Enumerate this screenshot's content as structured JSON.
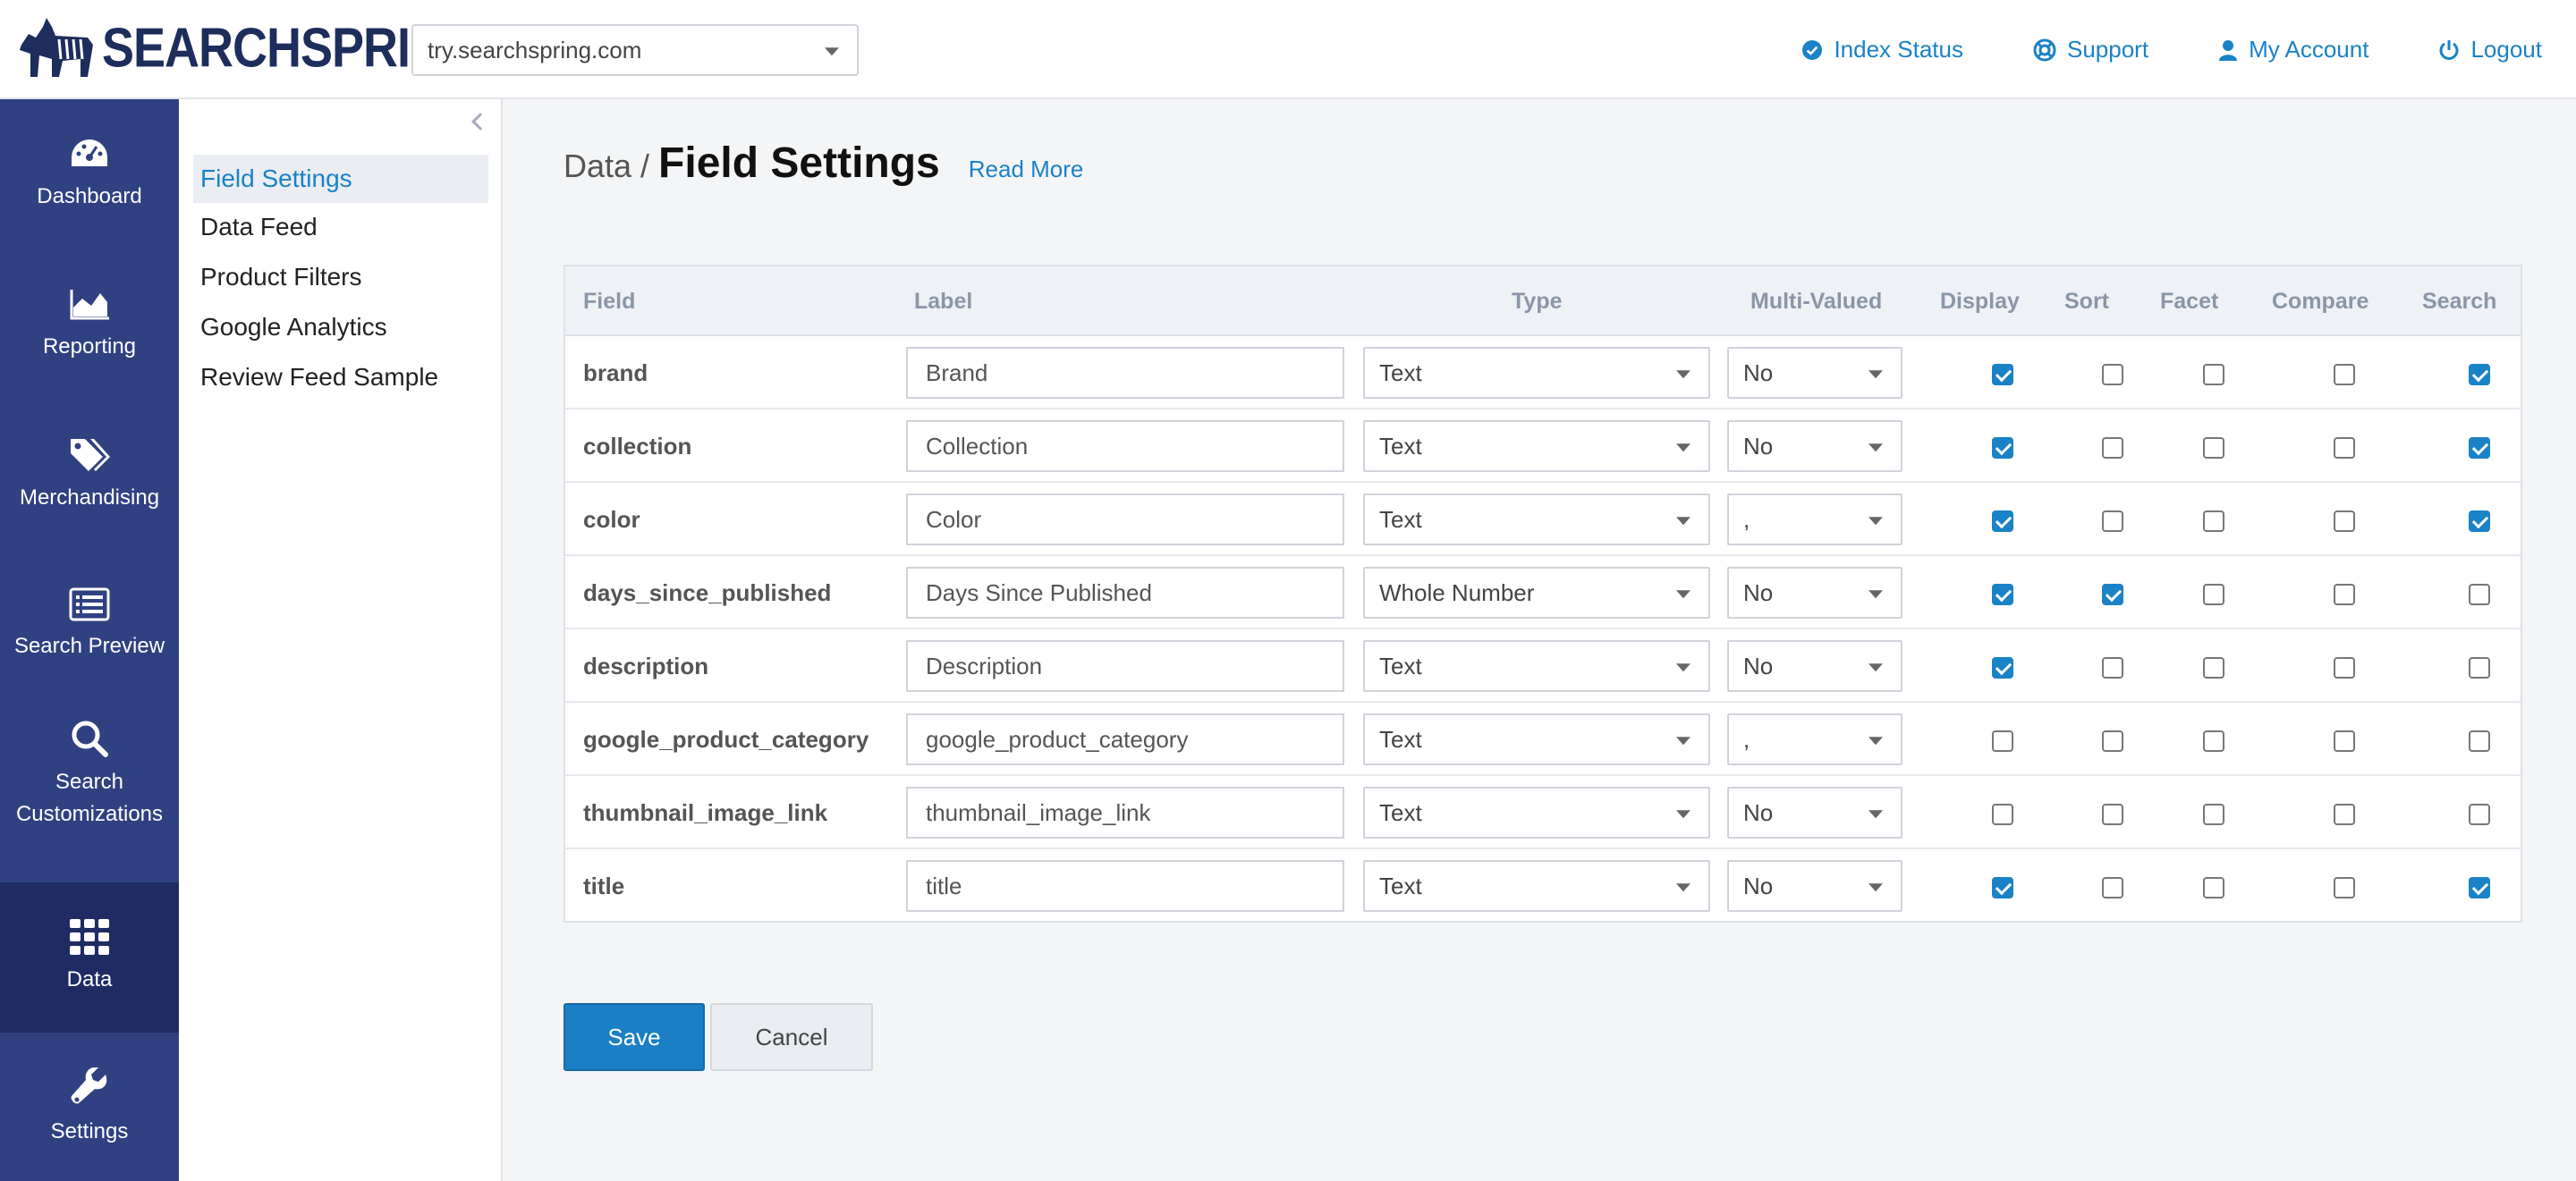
{
  "brand": {
    "name": "SEARCHSPRING",
    "reg": "®"
  },
  "site_selector": {
    "value": "try.searchspring.com"
  },
  "topnav": {
    "index_status": "Index Status",
    "support": "Support",
    "my_account": "My Account",
    "logout": "Logout"
  },
  "sidebar": {
    "items": [
      {
        "label": "Dashboard",
        "icon": "gauge-icon"
      },
      {
        "label": "Reporting",
        "icon": "area-chart-icon"
      },
      {
        "label": "Merchandising",
        "icon": "tags-icon"
      },
      {
        "label": "Search Preview",
        "icon": "list-icon"
      },
      {
        "label": "Search Customizations",
        "icon": "search-icon"
      },
      {
        "label": "Data",
        "icon": "grid-icon",
        "active": true
      },
      {
        "label": "Settings",
        "icon": "wrench-icon"
      }
    ]
  },
  "submenu": {
    "items": [
      {
        "label": "Field Settings",
        "active": true
      },
      {
        "label": "Data Feed"
      },
      {
        "label": "Product Filters"
      },
      {
        "label": "Google Analytics"
      },
      {
        "label": "Review Feed Sample"
      }
    ]
  },
  "page": {
    "crumb": "Data /",
    "title": "Field Settings",
    "read_more": "Read More"
  },
  "table": {
    "headers": {
      "field": "Field",
      "label": "Label",
      "type": "Type",
      "multi": "Multi-Valued",
      "display": "Display",
      "sort": "Sort",
      "facet": "Facet",
      "compare": "Compare",
      "search": "Search"
    },
    "rows": [
      {
        "field": "brand",
        "label": "Brand",
        "type": "Text",
        "multi": "No",
        "display": true,
        "sort": false,
        "facet": false,
        "compare": false,
        "search": true
      },
      {
        "field": "collection",
        "label": "Collection",
        "type": "Text",
        "multi": "No",
        "display": true,
        "sort": false,
        "facet": false,
        "compare": false,
        "search": true
      },
      {
        "field": "color",
        "label": "Color",
        "type": "Text",
        "multi": ",",
        "display": true,
        "sort": false,
        "facet": false,
        "compare": false,
        "search": true
      },
      {
        "field": "days_since_published",
        "label": "Days Since Published",
        "type": "Whole Number",
        "multi": "No",
        "display": true,
        "sort": true,
        "facet": false,
        "compare": false,
        "search": false
      },
      {
        "field": "description",
        "label": "Description",
        "type": "Text",
        "multi": "No",
        "display": true,
        "sort": false,
        "facet": false,
        "compare": false,
        "search": false
      },
      {
        "field": "google_product_category",
        "label": "google_product_category",
        "type": "Text",
        "multi": ",",
        "display": false,
        "sort": false,
        "facet": false,
        "compare": false,
        "search": false
      },
      {
        "field": "thumbnail_image_link",
        "label": "thumbnail_image_link",
        "type": "Text",
        "multi": "No",
        "display": false,
        "sort": false,
        "facet": false,
        "compare": false,
        "search": false
      },
      {
        "field": "title",
        "label": "title",
        "type": "Text",
        "multi": "No",
        "display": true,
        "sort": false,
        "facet": false,
        "compare": false,
        "search": true
      }
    ]
  },
  "actions": {
    "save": "Save",
    "cancel": "Cancel"
  },
  "colors": {
    "accent": "#1a82c6",
    "sidebar": "#304181",
    "sidebar_active": "#1f2c63"
  }
}
